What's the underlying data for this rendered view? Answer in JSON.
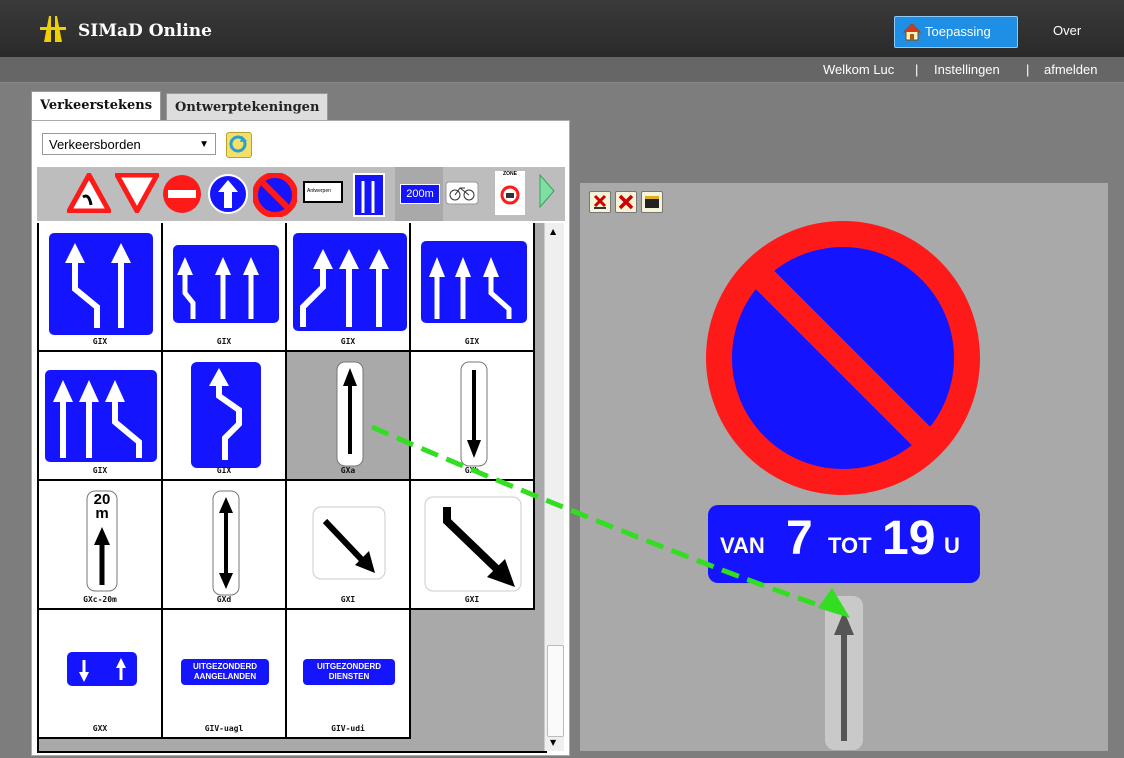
{
  "header": {
    "title": "SIMaD Online",
    "nav": [
      {
        "label": "Toepassing",
        "active": true
      },
      {
        "label": "Over",
        "active": false
      }
    ]
  },
  "userbar": {
    "welcome": "Welkom Luc",
    "sep": "|",
    "settings": "Instellingen",
    "logout": "afmelden"
  },
  "tabs": [
    {
      "label": "Verkeerstekens",
      "active": true
    },
    {
      "label": "Ontwerptekeningen",
      "active": false
    }
  ],
  "category_select": {
    "value": "Verkeersborden"
  },
  "category_icons": [
    "triangle-warning-icon",
    "yield-icon",
    "no-entry-icon",
    "mandatory-straight-icon",
    "no-parking-icon",
    "place-name-sign-icon",
    "lane-sign-icon",
    "distance-200m-icon",
    "bicycle-icon",
    "zone-icon",
    "more-arrow-icon"
  ],
  "category_icon_text": {
    "place": "Antwerpen",
    "distance": "200m",
    "zone": "ZONE"
  },
  "signs": [
    {
      "caption": "GIX",
      "kind": "lanes-2-merge"
    },
    {
      "caption": "GIX",
      "kind": "lanes-3-merge"
    },
    {
      "caption": "GIX",
      "kind": "lanes-4-merge"
    },
    {
      "caption": "GIX",
      "kind": "lanes-3-split"
    },
    {
      "caption": "GIX",
      "kind": "lanes-3-split-right"
    },
    {
      "caption": "GIX",
      "kind": "lane-shift"
    },
    {
      "caption": "GXa",
      "kind": "arrow-up",
      "selected": true
    },
    {
      "caption": "GXb",
      "kind": "arrow-down"
    },
    {
      "caption": "GXc-20m",
      "kind": "arrow-20m",
      "text1": "20",
      "text2": "m"
    },
    {
      "caption": "GXd",
      "kind": "arrow-both"
    },
    {
      "caption": "GXI",
      "kind": "arrow-diag-small"
    },
    {
      "caption": "GXI",
      "kind": "arrow-diag-large"
    },
    {
      "caption": "GXX",
      "kind": "two-way"
    },
    {
      "caption": "GIV-uagl",
      "kind": "text-plate",
      "line1": "UITGEZONDERD",
      "line2": "AANGELANDEN"
    },
    {
      "caption": "GIV-udi",
      "kind": "text-plate",
      "line1": "UITGEZONDERD",
      "line2": "DIENSTEN"
    }
  ],
  "canvas": {
    "tools": [
      "delete-selected-icon",
      "delete-all-icon",
      "export-icon"
    ],
    "subplate": {
      "w1": "VAN",
      "n1": "7",
      "w2": "TOT",
      "n2": "19",
      "unit": "U"
    }
  },
  "colors": {
    "sign_blue": "#1414ff",
    "sign_red": "#ff1a1a",
    "accent": "#1f8fe5",
    "drag_arrow": "#33dd22"
  }
}
